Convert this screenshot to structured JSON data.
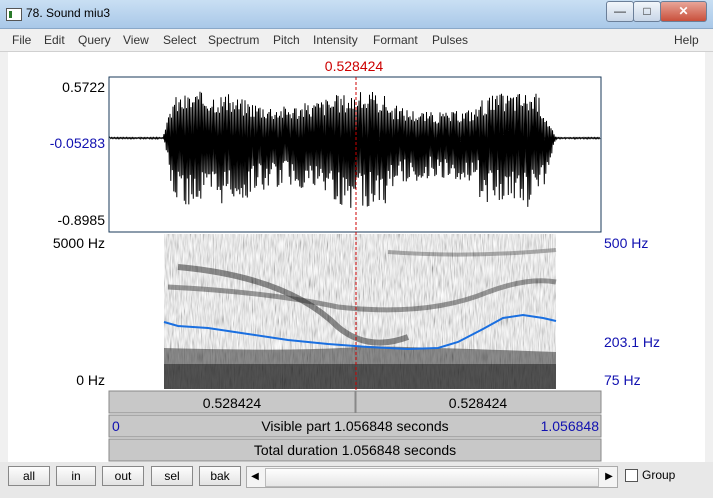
{
  "window": {
    "title": "78. Sound miu3",
    "min": "—",
    "max": "□",
    "close": "✕"
  },
  "menu": [
    "File",
    "Edit",
    "Query",
    "View",
    "Select",
    "Spectrum",
    "Pitch",
    "Intensity",
    "Formant",
    "Pulses"
  ],
  "help": "Help",
  "cursor": {
    "time_label": "0.528424"
  },
  "waveform": {
    "max_label": "0.5722",
    "zero_label": "-0.05283",
    "min_label": "-0.8985"
  },
  "spectrogram": {
    "top_label": "5000 Hz",
    "bottom_label": "0 Hz"
  },
  "pitch": {
    "top_label": "500 Hz",
    "value_label": "203.1 Hz",
    "bottom_label": "75 Hz"
  },
  "bars": {
    "left_time": "0.528424",
    "right_time": "0.528424",
    "visible_start": "0",
    "visible_text": "Visible part 1.056848 seconds",
    "visible_end": "1.056848",
    "total_text": "Total duration 1.056848 seconds"
  },
  "buttons": {
    "all": "all",
    "in": "in",
    "out": "out",
    "sel": "sel",
    "bak": "bak"
  },
  "scroll": {
    "left": "◀",
    "right": "▶"
  },
  "group_label": "Group",
  "colors": {
    "cursor": "#cc0000",
    "axis_blue": "#1010b0",
    "pitch_line": "#1a6fe0"
  }
}
